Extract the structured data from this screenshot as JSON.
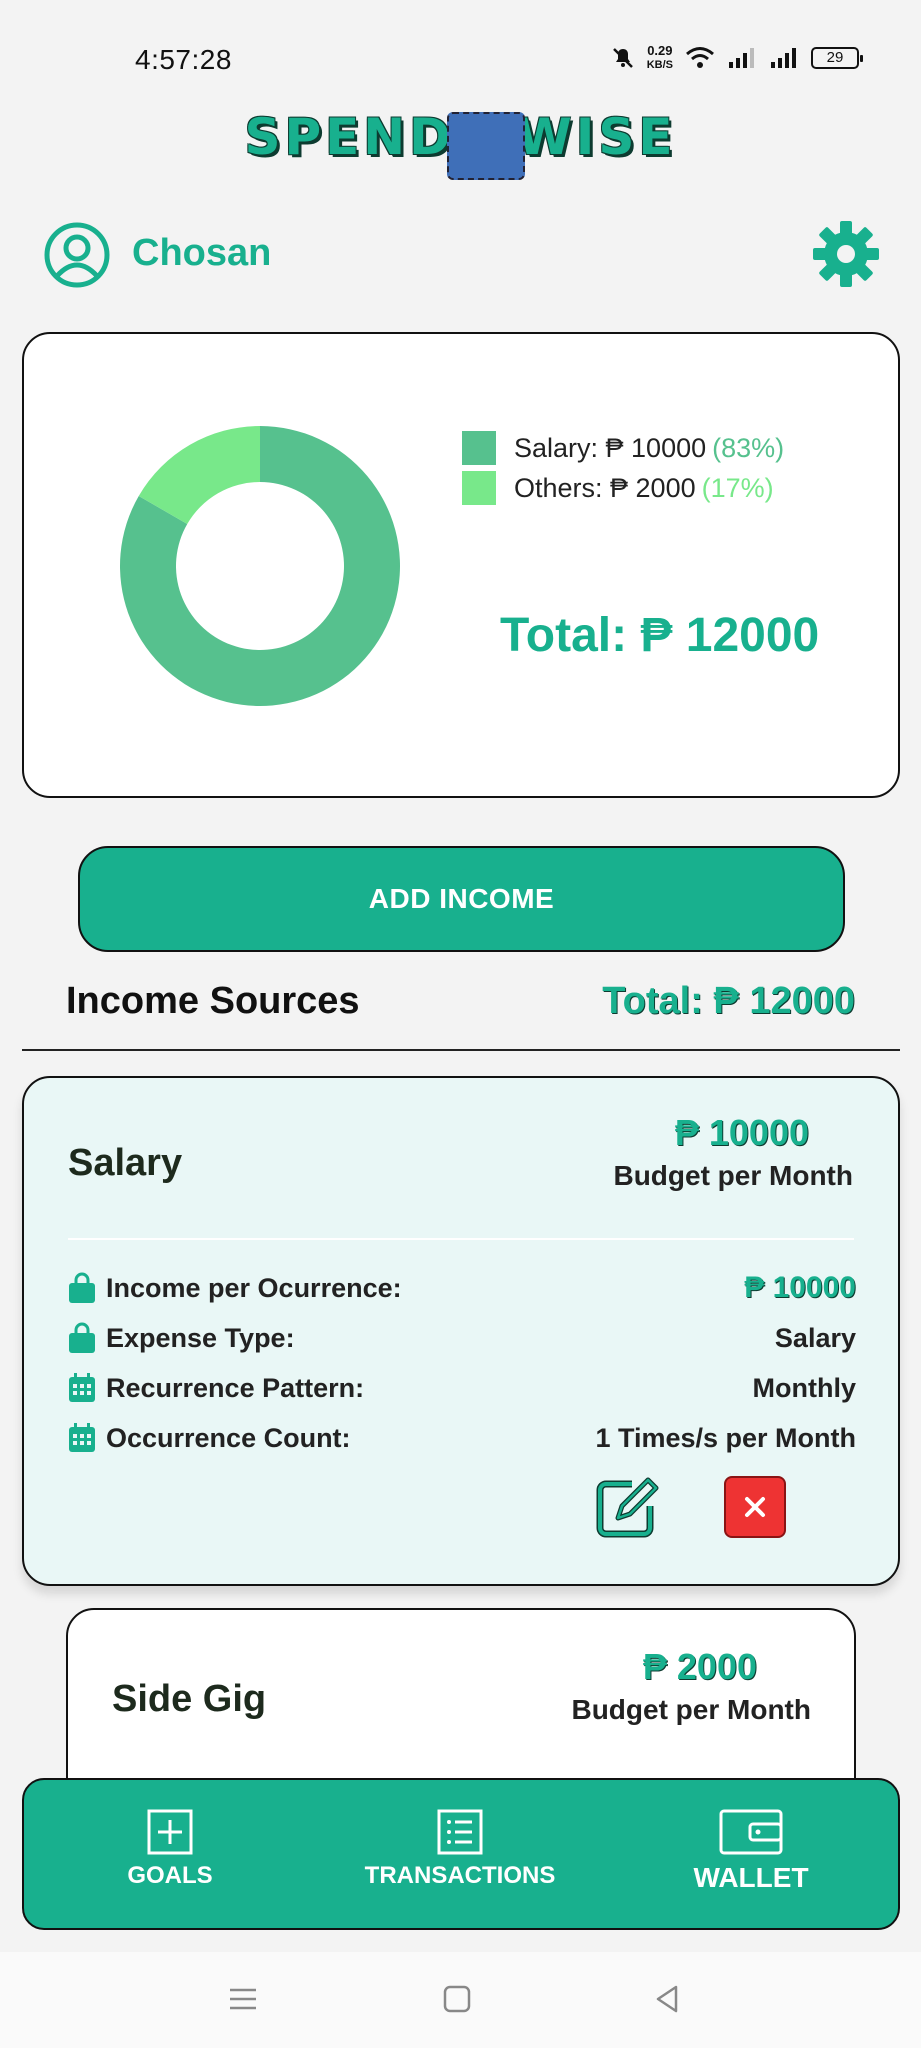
{
  "status_bar": {
    "time": "4:57:28",
    "net_speed_value": "0.29",
    "net_speed_unit": "KB/S",
    "battery": "29"
  },
  "app": {
    "logo_left": "SPEND",
    "logo_right": "WISE"
  },
  "profile": {
    "username": "Chosan"
  },
  "chart_card": {
    "legend": [
      {
        "label": "Salary: ₱ 10000",
        "pct": "(83%)"
      },
      {
        "label": "Others: ₱ 2000",
        "pct": "(17%)"
      }
    ],
    "total": "Total: ₱ 12000"
  },
  "chart_data": {
    "type": "pie",
    "categories": [
      "Salary",
      "Others"
    ],
    "values": [
      10000,
      2000
    ],
    "colors": [
      "#56c18e",
      "#78e88a"
    ]
  },
  "actions": {
    "add_income": "ADD INCOME"
  },
  "income_sources": {
    "title": "Income Sources",
    "total": "Total: ₱ 12000",
    "items": [
      {
        "name": "Salary",
        "amount": "₱ 10000",
        "amount_sub": "Budget per Month",
        "details": [
          {
            "label": "Income per Ocurrence:",
            "value": "₱ 10000",
            "icon": "shopping-bag-icon"
          },
          {
            "label": "Expense Type:",
            "value": "Salary",
            "icon": "shopping-bag-icon"
          },
          {
            "label": "Recurrence Pattern:",
            "value": "Monthly",
            "icon": "calendar-icon"
          },
          {
            "label": "Occurrence Count:",
            "value": "1 Times/s per Month",
            "icon": "calendar-icon"
          }
        ]
      },
      {
        "name": "Side Gig",
        "amount": "₱ 2000",
        "amount_sub": "Budget per Month"
      }
    ]
  },
  "bottom_nav": {
    "goals": "GOALS",
    "transactions": "TRANSACTIONS",
    "wallet": "WALLET"
  },
  "theme": {
    "accent": "#18b08e",
    "danger": "#ee3333"
  }
}
